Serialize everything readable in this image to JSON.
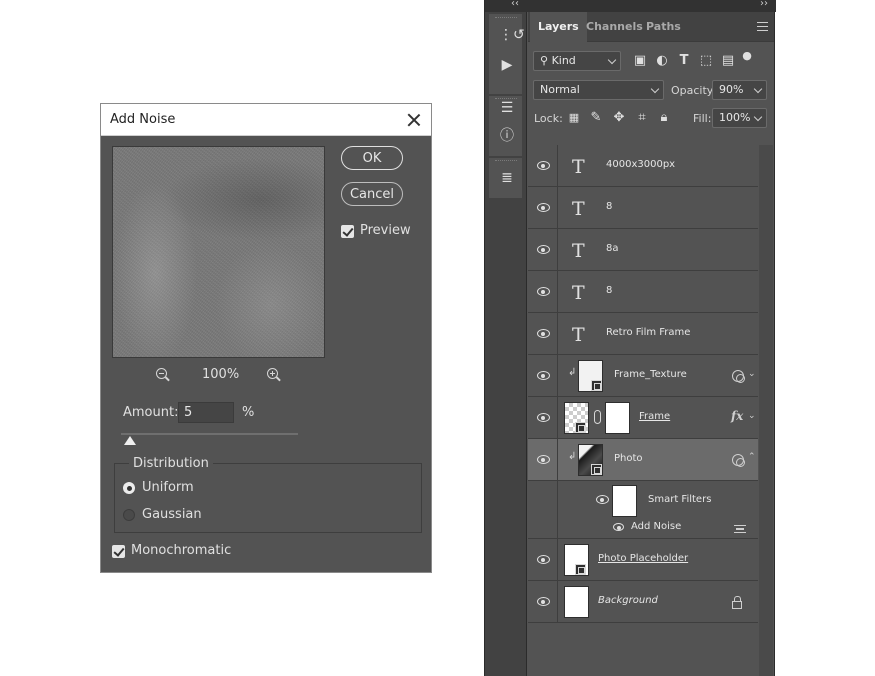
{
  "dialog": {
    "title": "Add Noise",
    "ok_label": "OK",
    "cancel_label": "Cancel",
    "preview_label": "Preview",
    "preview_checked": true,
    "zoom_level": "100%",
    "amount_label": "Amount:",
    "amount_value": "5",
    "amount_unit": "%",
    "amount_slider_fraction": 0.05,
    "distribution_title": "Distribution",
    "uniform_label": "Uniform",
    "gaussian_label": "Gaussian",
    "selected_distribution": "Uniform",
    "monochromatic_label": "Monochromatic",
    "monochromatic_checked": true
  },
  "panel": {
    "tabs": [
      {
        "label": "Layers",
        "active": true
      },
      {
        "label": "Channels",
        "active": false
      },
      {
        "label": "Paths",
        "active": false
      }
    ],
    "filter_kind": "Kind",
    "blend_mode": "Normal",
    "opacity_label": "Opacity:",
    "opacity_value": "90%",
    "lock_label": "Lock:",
    "fill_label": "Fill:",
    "fill_value": "100%",
    "layers": [
      {
        "name": "4000x3000px",
        "type": "text"
      },
      {
        "name": "8",
        "type": "text"
      },
      {
        "name": "8a",
        "type": "text"
      },
      {
        "name": "8",
        "type": "text"
      },
      {
        "name": "Retro Film Frame",
        "type": "text"
      },
      {
        "name": "Frame_Texture",
        "type": "smart"
      },
      {
        "name": "Frame",
        "type": "masked"
      },
      {
        "name": "Photo",
        "type": "smart",
        "selected": true
      },
      {
        "name": "Smart Filters",
        "type": "smart-filters"
      },
      {
        "name": "Add Noise",
        "type": "filter"
      },
      {
        "name": "Photo Placeholder",
        "type": "smart"
      },
      {
        "name": "Background",
        "type": "background"
      }
    ]
  }
}
